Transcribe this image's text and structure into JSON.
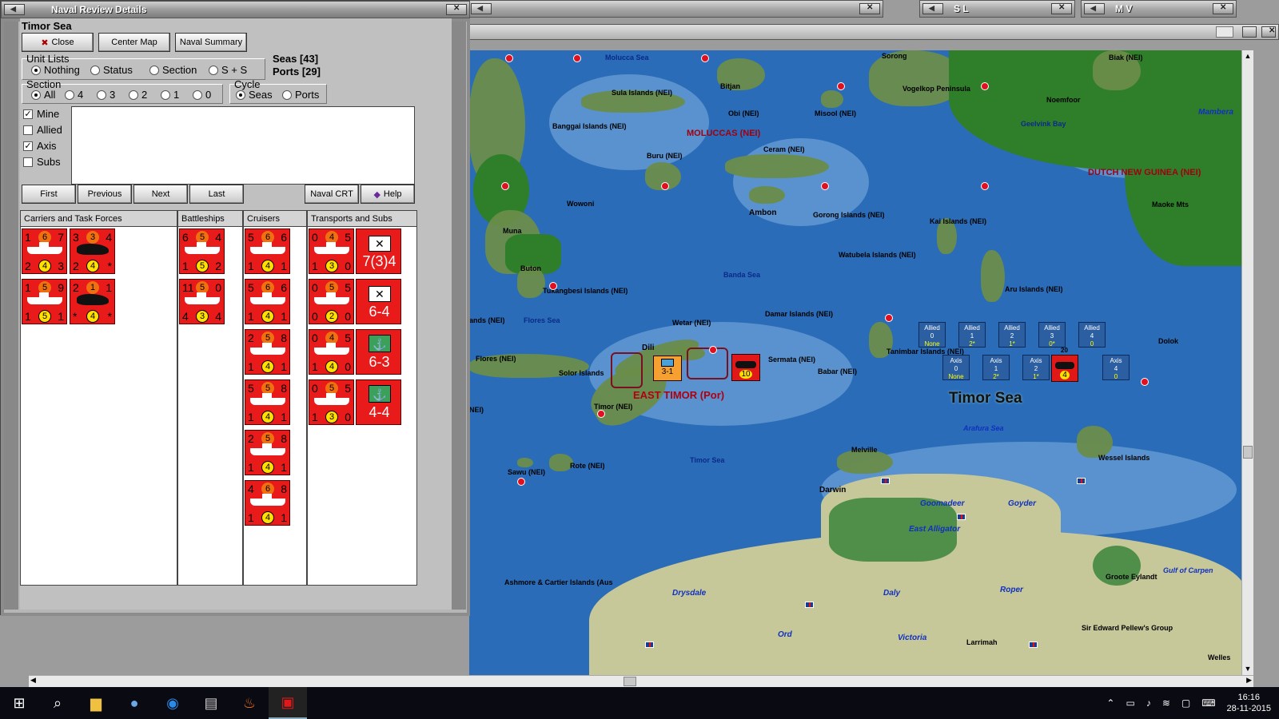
{
  "dialog": {
    "title": "Naval Review Details",
    "sea_name": "Timor Sea",
    "buttons": {
      "close": "Close",
      "center_map": "Center Map",
      "naval_summary": "Naval Summary",
      "first": "First",
      "previous": "Previous",
      "next": "Next",
      "last": "Last",
      "naval_crt": "Naval CRT",
      "help": "Help"
    },
    "unit_lists": {
      "label": "Unit Lists",
      "options": [
        "Nothing",
        "Status",
        "Section",
        "S + S"
      ],
      "selected": "Nothing"
    },
    "counts": {
      "seas": "Seas [43]",
      "ports": "Ports [29]"
    },
    "section": {
      "label": "Section",
      "options": [
        "All",
        "4",
        "3",
        "2",
        "1",
        "0"
      ],
      "selected": "All"
    },
    "cycle": {
      "label": "Cycle",
      "options": [
        "Seas",
        "Ports"
      ],
      "selected": "Seas"
    },
    "filters": [
      {
        "label": "Mine",
        "checked": true
      },
      {
        "label": "Allied",
        "checked": false
      },
      {
        "label": "Axis",
        "checked": true
      },
      {
        "label": "Subs",
        "checked": false
      }
    ],
    "columns": [
      "Carriers and Task Forces",
      "Battleships",
      "Cruisers",
      "Transports and Subs"
    ],
    "carriers": [
      {
        "tl": "1",
        "tm": "6",
        "tr": "7",
        "bl": "2",
        "bm": "4",
        "br": "3",
        "kind": "ship"
      },
      {
        "tl": "3",
        "tm": "3",
        "tr": "4",
        "bl": "2",
        "bm": "4",
        "br": "*",
        "kind": "air"
      },
      {
        "tl": "1",
        "tm": "5",
        "tr": "9",
        "bl": "1",
        "bm": "5",
        "br": "1",
        "kind": "ship"
      },
      {
        "tl": "2",
        "tm": "1",
        "tr": "1",
        "bl": "*",
        "bm": "4",
        "br": "*",
        "kind": "air"
      }
    ],
    "battleships": [
      {
        "tl": "6",
        "tm": "5",
        "tr": "4",
        "bl": "1",
        "bm": "5",
        "br": "2"
      },
      {
        "tl": "11",
        "tm": "5",
        "tr": "0",
        "bl": "4",
        "bm": "3",
        "br": "4"
      }
    ],
    "cruisers": [
      {
        "tl": "5",
        "tm": "6",
        "tr": "6",
        "bl": "1",
        "bm": "4",
        "br": "1"
      },
      {
        "tl": "5",
        "tm": "6",
        "tr": "6",
        "bl": "1",
        "bm": "4",
        "br": "1"
      },
      {
        "tl": "2",
        "tm": "5",
        "tr": "8",
        "bl": "1",
        "bm": "4",
        "br": "1"
      },
      {
        "tl": "5",
        "tm": "5",
        "tr": "8",
        "bl": "1",
        "bm": "4",
        "br": "1"
      },
      {
        "tl": "2",
        "tm": "5",
        "tr": "8",
        "bl": "1",
        "bm": "4",
        "br": "1"
      },
      {
        "tl": "4",
        "tm": "6",
        "tr": "8",
        "bl": "1",
        "bm": "4",
        "br": "1"
      }
    ],
    "transports": [
      {
        "tl": "0",
        "tm": "4",
        "tr": "5",
        "bl": "1",
        "bm": "3",
        "br": "0"
      },
      {
        "tl": "0",
        "tm": "5",
        "tr": "5",
        "bl": "0",
        "bm": "2",
        "br": "0"
      },
      {
        "tl": "0",
        "tm": "4",
        "tr": "5",
        "bl": "1",
        "bm": "4",
        "br": "0"
      },
      {
        "tl": "0",
        "tm": "5",
        "tr": "5",
        "bl": "1",
        "bm": "3",
        "br": "0"
      }
    ],
    "subs": [
      {
        "value": "7(3)4",
        "icon": "envelope"
      },
      {
        "value": "6-4",
        "icon": "envelope"
      },
      {
        "value": "6-3",
        "icon": "anchor"
      },
      {
        "value": "4-4",
        "icon": "anchor"
      }
    ]
  },
  "top_windows": {
    "sl": "S L",
    "mv": "M V"
  },
  "map": {
    "labels": {
      "molucca_sea": "Molucca Sea",
      "sorong": "Sorong",
      "biak": "Biak (NEI)",
      "vogelkop": "Vogelkop Peninsula",
      "noemfoor": "Noemfoor",
      "geelvink": "Geelvink Bay",
      "mamberamo": "Mambera",
      "sula": "Sula Islands (NEI)",
      "bitjan": "Bitjan",
      "obi": "Obi (NEI)",
      "misool": "Misool (NEI)",
      "banggai": "Banggai Islands (NEI)",
      "moluccas": "MOLUCCAS (NEI)",
      "buru": "Buru (NEI)",
      "ceram": "Ceram (NEI)",
      "dng": "DUTCH NEW GUINEA (NEI)",
      "wowoni": "Wowoni",
      "ambon": "Ambon",
      "gorong": "Gorong Islands (NEI)",
      "kai": "Kai Islands (NEI)",
      "maoke": "Maoke Mts",
      "muna": "Muna",
      "buton": "Buton",
      "watubela": "Watubela Islands (NEI)",
      "banda": "Banda Sea",
      "tukangbesi": "Tukangbesi Islands (NEI)",
      "aru": "Aru Islands (NEI)",
      "damar": "Damar Islands (NEI)",
      "wetar": "Wetar (NEI)",
      "flores_sea": "Flores Sea",
      "dili": "Dili",
      "sermata": "Sermata (NEI)",
      "babar": "Babar (NEI)",
      "tanimbar": "Tanimbar Islands (NEI)",
      "flores": "Flores (NEI)",
      "solor": "Solor Islands",
      "east_timor": "EAST TIMOR (Por)",
      "timor": "Timor (NEI)",
      "timor_sea_big": "Timor Sea",
      "arafura": "Arafura Sea",
      "dolok": "Dolok",
      "melville": "Melville",
      "wessel": "Wessel Islands",
      "timor_sea_small": "Timor Sea",
      "sawu": "Sawu (NEI)",
      "rote": "Rote (NEI)",
      "darwin": "Darwin",
      "goomadeer": "Goomadeer",
      "goyder": "Goyder",
      "east_alligator": "East Alligator",
      "groote": "Groote Eylandt",
      "carpentaria": "Gulf of Carpen",
      "ashmore": "Ashmore & Cartier Islands (Aus",
      "drysdale": "Drysdale",
      "daly": "Daly",
      "roper": "Roper",
      "ord": "Ord",
      "victoria": "Victoria",
      "larrimah": "Larrimah",
      "pellew": "Sir Edward Pellew's Group",
      "wellesley": "Welles",
      "nei_left": "ands (NEI)",
      "nei_left2": "NEI)"
    },
    "allied_chips": [
      {
        "name": "Allied",
        "n": "0",
        "v": "None"
      },
      {
        "name": "Allied",
        "n": "1",
        "v": "2*"
      },
      {
        "name": "Allied",
        "n": "2",
        "v": "1*"
      },
      {
        "name": "Allied",
        "n": "3",
        "v": "0*"
      },
      {
        "name": "Allied",
        "n": "4",
        "v": "0"
      }
    ],
    "axis_chips": [
      {
        "name": "Axis",
        "n": "0",
        "v": "None"
      },
      {
        "name": "Axis",
        "n": "1",
        "v": "2*"
      },
      {
        "name": "Axis",
        "n": "2",
        "v": "1*"
      },
      {
        "name": "Axis",
        "n": "4",
        "v": "0"
      }
    ],
    "unit_counter_1": "3-1",
    "unit_counter_2": "10",
    "unit_counter_3": "4",
    "unit_counter_3_top": "20"
  },
  "taskbar": {
    "time": "16:16",
    "date": "28-11-2015"
  }
}
